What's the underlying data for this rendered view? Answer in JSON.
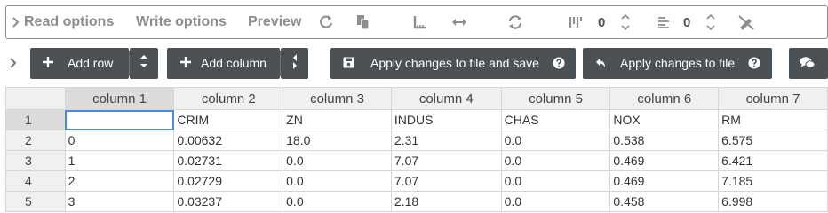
{
  "toolbar": {
    "read_options": "Read options",
    "write_options": "Write options",
    "preview": "Preview",
    "column_count": "0",
    "row_count": "0",
    "icons": [
      "chevron-right-icon",
      "refresh-icon",
      "copy-icon",
      "ruler-icon",
      "resize-arrows-icon",
      "sync-icon",
      "column-bars-icon",
      "stepper-icon",
      "rows-lines-icon",
      "stepper-icon",
      "no-draw-icon"
    ]
  },
  "actions": {
    "add_row": "Add row",
    "add_column": "Add column",
    "apply_save": "Apply changes to file and save",
    "apply": "Apply changes to file"
  },
  "grid": {
    "columns": [
      "column 1",
      "column 2",
      "column 3",
      "column 4",
      "column 5",
      "column 6",
      "column 7"
    ],
    "rows": [
      {
        "num": "1",
        "cells": [
          "",
          "CRIM",
          "ZN",
          "INDUS",
          "CHAS",
          "NOX",
          "RM"
        ]
      },
      {
        "num": "2",
        "cells": [
          "0",
          "0.00632",
          "18.0",
          "2.31",
          "0.0",
          "0.538",
          "6.575"
        ]
      },
      {
        "num": "3",
        "cells": [
          "1",
          "0.02731",
          "0.0",
          "7.07",
          "0.0",
          "0.469",
          "6.421"
        ]
      },
      {
        "num": "4",
        "cells": [
          "2",
          "0.02729",
          "0.0",
          "7.07",
          "0.0",
          "0.469",
          "7.185"
        ]
      },
      {
        "num": "5",
        "cells": [
          "3",
          "0.03237",
          "0.0",
          "2.18",
          "0.0",
          "0.458",
          "6.998"
        ]
      }
    ]
  },
  "colors": {
    "button_bg": "#4c5155",
    "selection_border": "#4b89dc",
    "header_bg": "#f0f0f0",
    "active_header_bg": "#dcdcdc"
  }
}
